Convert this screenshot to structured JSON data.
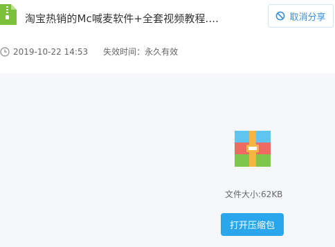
{
  "file": {
    "title": "淘宝热销的Mc喊麦软件+全套视频教程....",
    "icon": "zip-file-icon",
    "accent_color": "#7cbf3a"
  },
  "actions": {
    "cancel_share_label": "取消分享",
    "cancel_share_icon": "ban-icon"
  },
  "meta": {
    "clock_icon": "clock-icon",
    "share_time": "2019-10-22 14:53",
    "expiry_label": "失效时间：",
    "expiry_value": "永久有效"
  },
  "preview": {
    "archive_icon": "archive-icon",
    "file_size": "文件大小:62KB",
    "open_button_label": "打开压缩包",
    "button_color": "#2aa6ec"
  }
}
